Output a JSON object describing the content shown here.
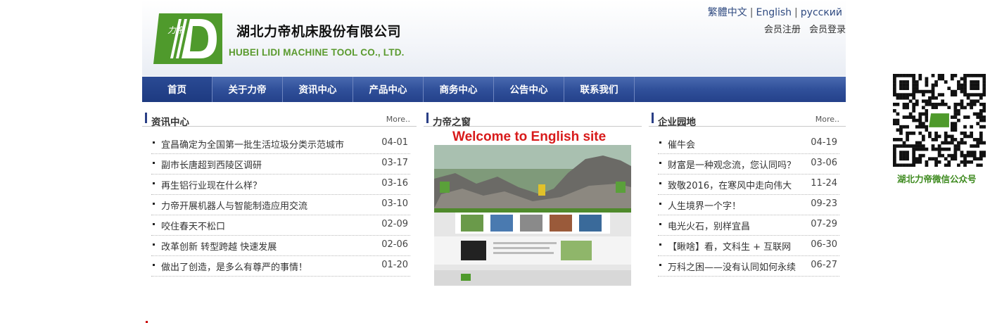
{
  "header": {
    "company_cn": "湖北力帝机床股份有限公司",
    "company_en": "HUBEI LIDI MACHINE TOOL CO., LTD.",
    "logo_chars": "力帝",
    "languages": [
      "繁體中文",
      "English",
      "русский"
    ],
    "member": [
      "会员注册",
      "会员登录"
    ]
  },
  "nav": [
    "首页",
    "关于力帝",
    "资讯中心",
    "产品中心",
    "商务中心",
    "公告中心",
    "联系我们"
  ],
  "news": {
    "title": "资讯中心",
    "more": "More..",
    "items": [
      {
        "title": "宜昌确定为全国第一批生活垃圾分类示范城市",
        "date": "04-01"
      },
      {
        "title": "副市长唐超到西陵区调研",
        "date": "03-17"
      },
      {
        "title": "再生铝行业现在什么样？",
        "date": "03-16"
      },
      {
        "title": "力帝开展机器人与智能制造应用交流",
        "date": "03-10"
      },
      {
        "title": "咬住春天不松口",
        "date": "02-09"
      },
      {
        "title": "改革创新 转型跨越 快速发展",
        "date": "02-06"
      },
      {
        "title": "做出了创造，是多么有尊严的事情！",
        "date": "01-20"
      }
    ]
  },
  "window": {
    "title": "力帝之窗",
    "welcome": "Welcome to English site"
  },
  "culture": {
    "title": "企业园地",
    "more": "More..",
    "items": [
      {
        "title": "催牛会",
        "date": "04-19"
      },
      {
        "title": "财富是一种观念流，您认同吗？",
        "date": "03-06"
      },
      {
        "title": "致敬2016，在寒风中走向伟大",
        "date": "11-24"
      },
      {
        "title": "人生境界一个字！",
        "date": "09-23"
      },
      {
        "title": "电光火石，别样宜昌",
        "date": "07-29"
      },
      {
        "title": "【瞅啥】看，文科生 + 互联网",
        "date": "06-30"
      },
      {
        "title": "万科之困——没有认同如何永续",
        "date": "06-27"
      }
    ]
  },
  "qr": {
    "caption": "湖北力帝微信公众号"
  },
  "colors": {
    "brand_green": "#5a9a2e",
    "nav_blue": "#30509a",
    "welcome_red": "#d81b1b"
  }
}
